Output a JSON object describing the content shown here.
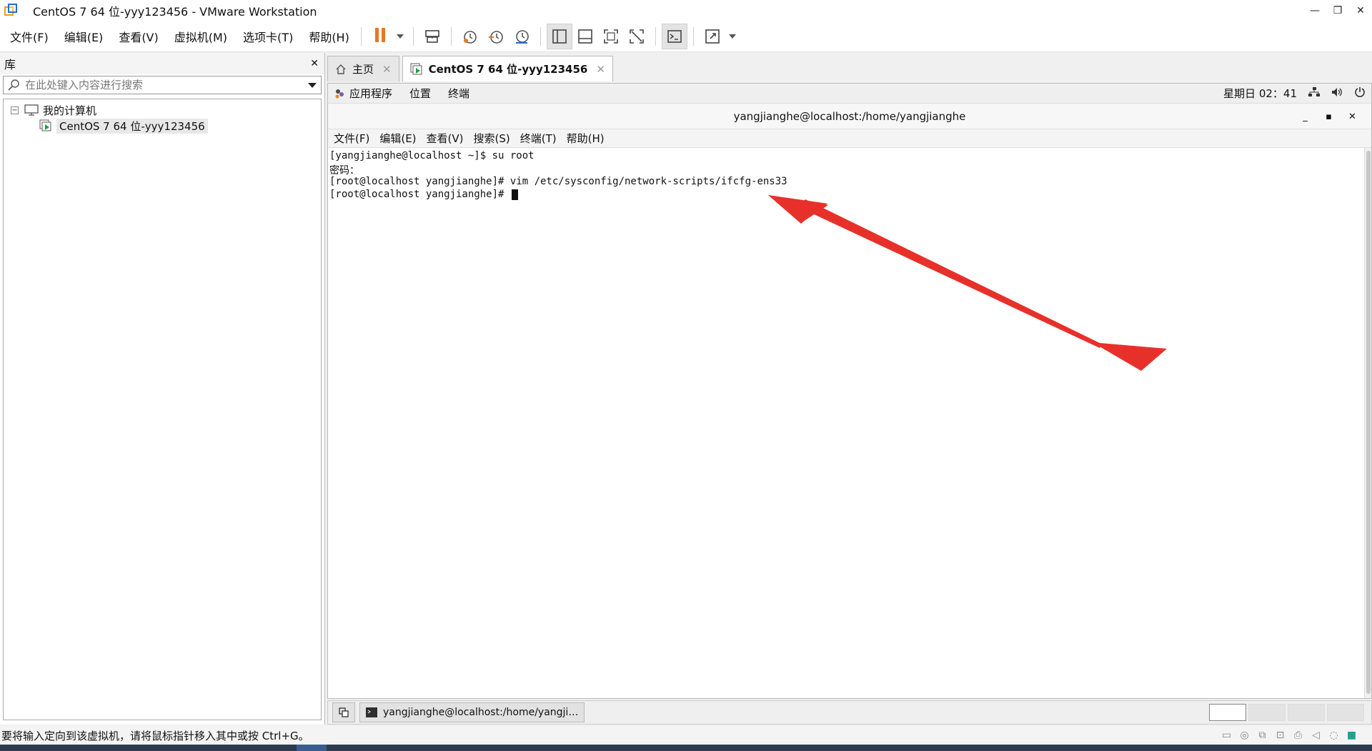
{
  "window": {
    "title": "CentOS 7 64 位-yyy123456 - VMware Workstation"
  },
  "menu": [
    "文件(F)",
    "编辑(E)",
    "查看(V)",
    "虚拟机(M)",
    "选项卡(T)",
    "帮助(H)"
  ],
  "library": {
    "title": "库",
    "close": "✕",
    "search_placeholder": "在此处键入内容进行搜索",
    "root": "我的计算机",
    "vm": "CentOS 7 64 位-yyy123456"
  },
  "tabs": [
    {
      "label": "主页"
    },
    {
      "label": "CentOS 7 64 位-yyy123456"
    }
  ],
  "gnome": {
    "apps": "应用程序",
    "places": "位置",
    "terminal": "终端",
    "clock": "星期日 02：41"
  },
  "terminal": {
    "title": "yangjianghe@localhost:/home/yangjianghe",
    "menu": [
      "文件(F)",
      "编辑(E)",
      "查看(V)",
      "搜索(S)",
      "终端(T)",
      "帮助(H)"
    ],
    "lines": [
      "[yangjianghe@localhost ~]$ su root",
      "密码：",
      "[root@localhost yangjianghe]# vim /etc/sysconfig/network-scripts/ifcfg-ens33",
      "[root@localhost yangjianghe]# "
    ]
  },
  "taskbar": {
    "window_label": "yangjianghe@localhost:/home/yangji…"
  },
  "status": {
    "text": "要将输入定向到该虚拟机，请将鼠标指针移入其中或按 Ctrl+G。"
  },
  "colors": {
    "annotation_arrow": "#e8302a",
    "pause": "#e87722",
    "accent": "#1f6fd1"
  }
}
